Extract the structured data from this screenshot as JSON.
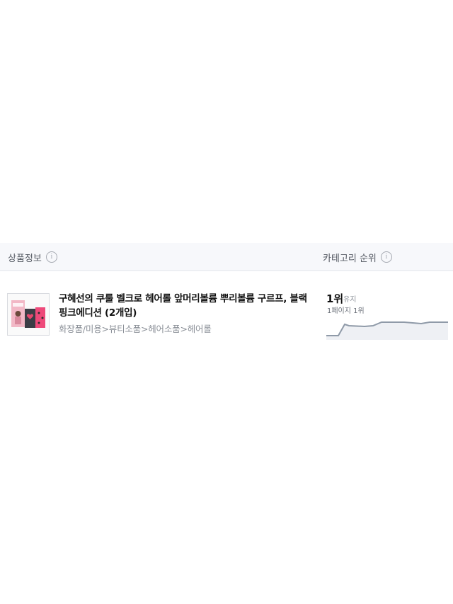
{
  "header": {
    "product_info_label": "상품정보",
    "category_rank_label": "카테고리 순위",
    "info_glyph": "i"
  },
  "product": {
    "title": "구혜선의 쿠룰 벨크로 헤어롤 앞머리볼륨 뿌리볼륨 구르프, 블랙핑크에디션 (2개입)",
    "category_path": "화장품/미용>뷰티소품>헤어소품>헤어롤",
    "rank": {
      "value": "1위",
      "change": "유지",
      "page_position": "1페이지 1위",
      "trend_color": "#8f9aa8",
      "trend_fill": "#eef0f4"
    }
  }
}
